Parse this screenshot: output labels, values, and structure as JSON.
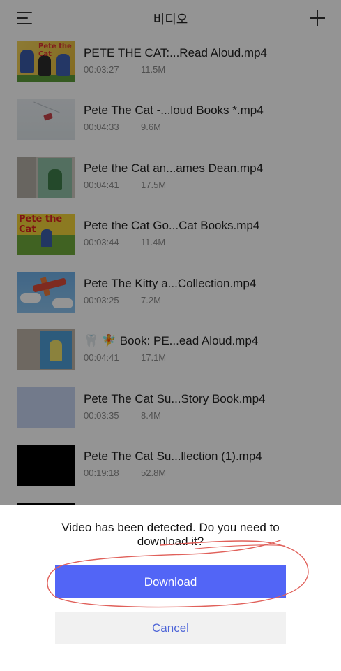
{
  "header": {
    "title": "비디오",
    "menu_icon": "menu-icon",
    "add_icon": "plus-icon"
  },
  "videos": [
    {
      "title": "PETE THE CAT:...Read Aloud.mp4",
      "duration": "00:03:27",
      "size": "11.5M"
    },
    {
      "title": "Pete The Cat -...loud Books *.mp4",
      "duration": "00:04:33",
      "size": "9.6M"
    },
    {
      "title": "Pete the Cat an...ames Dean.mp4",
      "duration": "00:04:41",
      "size": "17.5M"
    },
    {
      "title": "Pete the Cat Go...Cat Books.mp4",
      "duration": "00:03:44",
      "size": "11.4M"
    },
    {
      "title": "Pete The Kitty a...Collection.mp4",
      "duration": "00:03:25",
      "size": "7.2M"
    },
    {
      "title": "🦷 🧚 Book: PE...ead Aloud.mp4",
      "duration": "00:04:41",
      "size": "17.1M"
    },
    {
      "title": "Pete The Cat Su...Story Book.mp4",
      "duration": "00:03:35",
      "size": "8.4M"
    },
    {
      "title": "Pete The Cat Su...llection (1).mp4",
      "duration": "00:19:18",
      "size": "52.8M"
    }
  ],
  "thumb_text": {
    "t1": "Pete the Cat",
    "t4": "Pete the Cat"
  },
  "dialog": {
    "message": "Video has been detected. Do you need to download it?",
    "download_label": "Download",
    "cancel_label": "Cancel"
  },
  "colors": {
    "primary": "#5265f6",
    "cancel_text": "#4f66d8",
    "annotation": "#e0605a"
  }
}
